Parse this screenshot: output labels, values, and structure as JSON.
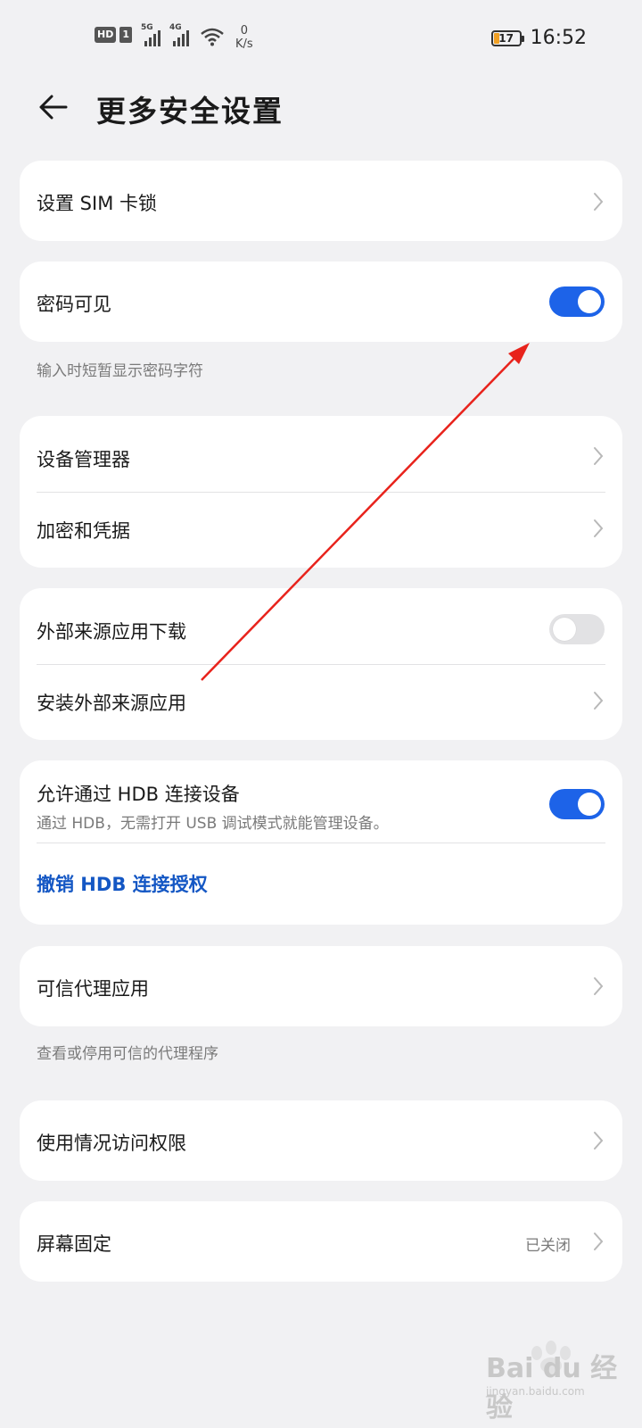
{
  "status_bar": {
    "hd_badge": "HD",
    "sim_number": "1",
    "sig1_tag": "5G",
    "sig2_tag": "4G",
    "speed_value": "0",
    "speed_unit": "K/s",
    "battery": "17",
    "time": "16:52",
    "battery_color": "#f0a024"
  },
  "header": {
    "title": "更多安全设置",
    "back_icon": "back-arrow-icon"
  },
  "settings": {
    "sim_lock": "设置 SIM 卡锁",
    "password_visible": {
      "label": "密码可见",
      "enabled": true,
      "note": "输入时短暂显示密码字符"
    },
    "device_manager": "设备管理器",
    "encryption": "加密和凭据",
    "external_download": {
      "label": "外部来源应用下载",
      "enabled": false
    },
    "install_external": "安装外部来源应用",
    "hdb": {
      "label": "允许通过 HDB 连接设备",
      "subtitle": "通过 HDB，无需打开 USB 调试模式就能管理设备。",
      "enabled": true,
      "revoke_link": "撤销 HDB 连接授权"
    },
    "trusted_agent": {
      "label": "可信代理应用",
      "note": "查看或停用可信的代理程序"
    },
    "usage_access": "使用情况访问权限",
    "screen_pinning": {
      "label": "屏幕固定",
      "value": "已关闭"
    }
  },
  "colors": {
    "accent": "#1d63e8",
    "link": "#1457c4",
    "annotation_arrow": "#e8231c",
    "background": "#f1f1f3"
  },
  "watermark": {
    "text": "Bai du 经验",
    "sub": "jingyan.baidu.com"
  }
}
